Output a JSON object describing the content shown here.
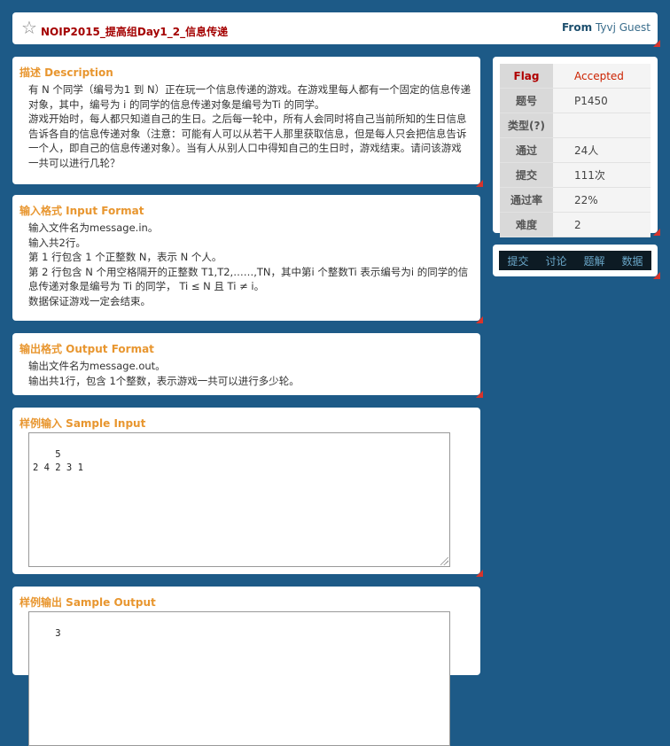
{
  "header": {
    "title": "NOIP2015_提高组Day1_2_信息传递",
    "from_label": "From",
    "from_user": "Tyvj Guest"
  },
  "description": {
    "title": "描述 Description",
    "lines": [
      "有 N 个同学（编号为1 到 N）正在玩一个信息传递的游戏。在游戏里每人都有一个固定的信息传递对象，其中，编号为 i 的同学的信息传递对象是编号为Ti 的同学。",
      "游戏开始时，每人都只知道自己的生日。之后每一轮中，所有人会同时将自己当前所知的生日信息告诉各自的信息传递对象（注意：可能有人可以从若干人那里获取信息，但是每人只会把信息告诉一个人，即自己的信息传递对象）。当有人从别人口中得知自己的生日时，游戏结束。请问该游戏一共可以进行几轮？"
    ]
  },
  "input_format": {
    "title": "输入格式 Input Format",
    "lines": [
      "输入文件名为message.in。",
      "输入共2行。",
      "第 1 行包含 1 个正整数 N，表示 N 个人。",
      "第 2 行包含 N 个用空格隔开的正整数 T1,T2,……,TN，其中第i 个整数Ti 表示编号为i 的同学的信息传递对象是编号为 Ti 的同学， Ti ≤ N 且 Ti ≠ i。",
      "数据保证游戏一定会结束。"
    ]
  },
  "output_format": {
    "title": "输出格式 Output Format",
    "lines": [
      "输出文件名为message.out。",
      "输出共1行，包含 1个整数，表示游戏一共可以进行多少轮。"
    ]
  },
  "sample_input": {
    "title": "样例输入 Sample Input",
    "content": "5\n2 4 2 3 1"
  },
  "sample_output": {
    "title": "样例输出 Sample Output",
    "content": "3"
  },
  "stats": {
    "rows": [
      {
        "key": "Flag",
        "value": "Accepted"
      },
      {
        "key": "题号",
        "value": "P1450"
      },
      {
        "key": "类型(?)",
        "value": ""
      },
      {
        "key": "通过",
        "value": "24人"
      },
      {
        "key": "提交",
        "value": "111次"
      },
      {
        "key": "通过率",
        "value": "22%"
      },
      {
        "key": "难度",
        "value": "2"
      }
    ]
  },
  "actions": {
    "submit": "提交",
    "discuss": "讨论",
    "solution": "题解",
    "data": "数据"
  }
}
